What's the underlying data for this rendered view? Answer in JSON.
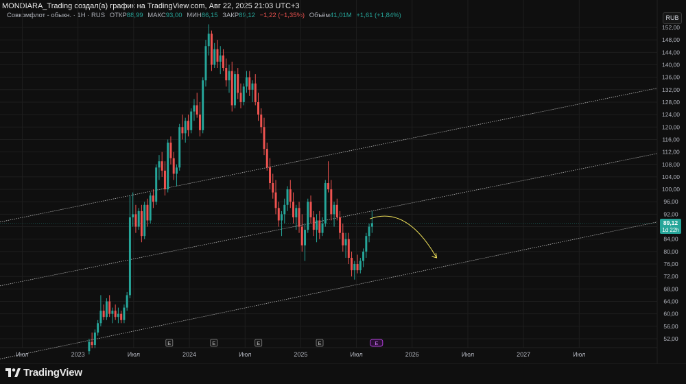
{
  "header": {
    "caption": "MONDIARA_Trading создал(а) график на TradingView.com, Авг 22, 2025 21:03 UTC+3"
  },
  "legend": {
    "symbol": "Совкомфлот - обыкн. · 1Н · RUS",
    "open_label": "ОТКР",
    "open_value": "88,99",
    "high_label": "МАКС",
    "high_value": "93,00",
    "low_label": "МИН",
    "low_value": "86,15",
    "close_label": "ЗАКР",
    "close_value": "89,12",
    "change": "−1,22 (−1,35%)",
    "volume_label": "Объём",
    "volume_value": "41,01M",
    "volume_change": "+1,61 (+1,84%)"
  },
  "currency_button": "RUB",
  "price_tag": {
    "price": "89,12",
    "countdown": "1d 22h"
  },
  "colors": {
    "up": "#26a69a",
    "down": "#ef5350",
    "background": "#0f0f0f",
    "grid": "#1e1e1e",
    "channel": "#d8d8d8",
    "arrow": "#f2e35a",
    "earnings_marker": "#b13fdb"
  },
  "earnings_marker_label": "E",
  "footer": {
    "brand": "TradingView",
    "brand_icon": "tradingview-logo-icon"
  },
  "chart_data": {
    "type": "candlestick",
    "title": "",
    "interval": "1W",
    "ylim": [
      50,
      154
    ],
    "y_ticks": [
      "52,00",
      "56,00",
      "60,00",
      "64,00",
      "68,00",
      "72,00",
      "76,00",
      "80,00",
      "84,00",
      "88,00",
      "92,00",
      "96,00",
      "100,00",
      "104,00",
      "108,00",
      "112,00",
      "116,00",
      "120,00",
      "124,00",
      "128,00",
      "132,00",
      "136,00",
      "140,00",
      "144,00",
      "148,00",
      "152,00"
    ],
    "x_ticks": [
      "Июл",
      "2023",
      "Июл",
      "2024",
      "Июл",
      "2025",
      "Июл",
      "2026",
      "Июл",
      "2027",
      "Июл"
    ],
    "last_price": 89.12,
    "earnings_markers": 6,
    "channel_lines": [
      {
        "name": "upper",
        "from": [
          2022.3,
          89.5
        ],
        "to": [
          2028.2,
          132.5
        ]
      },
      {
        "name": "middle",
        "from": [
          2022.3,
          69.0
        ],
        "to": [
          2028.2,
          111.5
        ]
      },
      {
        "name": "lower",
        "from": [
          2022.3,
          45.5
        ],
        "to": [
          2028.2,
          89.5
        ]
      }
    ],
    "projection_arrow": {
      "from": [
        2025.62,
        90.5
      ],
      "to": [
        2026.22,
        78.0
      ]
    },
    "candles": [
      {
        "o": 48,
        "h": 52,
        "l": 47,
        "c": 51
      },
      {
        "o": 51,
        "h": 54,
        "l": 49,
        "c": 50
      },
      {
        "o": 50,
        "h": 55,
        "l": 49,
        "c": 54
      },
      {
        "o": 54,
        "h": 58,
        "l": 53,
        "c": 57
      },
      {
        "o": 57,
        "h": 66,
        "l": 56,
        "c": 61
      },
      {
        "o": 61,
        "h": 63,
        "l": 58,
        "c": 59
      },
      {
        "o": 59,
        "h": 65,
        "l": 58,
        "c": 64
      },
      {
        "o": 64,
        "h": 66,
        "l": 59,
        "c": 60
      },
      {
        "o": 60,
        "h": 62,
        "l": 57,
        "c": 61
      },
      {
        "o": 61,
        "h": 63,
        "l": 58,
        "c": 59
      },
      {
        "o": 59,
        "h": 62,
        "l": 57,
        "c": 60
      },
      {
        "o": 60,
        "h": 61,
        "l": 57,
        "c": 58
      },
      {
        "o": 58,
        "h": 63,
        "l": 57,
        "c": 62
      },
      {
        "o": 62,
        "h": 67,
        "l": 61,
        "c": 66
      },
      {
        "o": 66,
        "h": 98,
        "l": 65,
        "c": 91
      },
      {
        "o": 91,
        "h": 99,
        "l": 88,
        "c": 92
      },
      {
        "o": 92,
        "h": 95,
        "l": 86,
        "c": 88
      },
      {
        "o": 88,
        "h": 94,
        "l": 87,
        "c": 93
      },
      {
        "o": 93,
        "h": 95,
        "l": 83,
        "c": 85
      },
      {
        "o": 85,
        "h": 96,
        "l": 84,
        "c": 95
      },
      {
        "o": 95,
        "h": 97,
        "l": 88,
        "c": 90
      },
      {
        "o": 90,
        "h": 99,
        "l": 89,
        "c": 98
      },
      {
        "o": 98,
        "h": 100,
        "l": 94,
        "c": 96
      },
      {
        "o": 96,
        "h": 108,
        "l": 95,
        "c": 107
      },
      {
        "o": 107,
        "h": 111,
        "l": 103,
        "c": 109
      },
      {
        "o": 109,
        "h": 112,
        "l": 104,
        "c": 106
      },
      {
        "o": 106,
        "h": 109,
        "l": 98,
        "c": 100
      },
      {
        "o": 100,
        "h": 116,
        "l": 99,
        "c": 115
      },
      {
        "o": 115,
        "h": 117,
        "l": 108,
        "c": 110
      },
      {
        "o": 110,
        "h": 112,
        "l": 103,
        "c": 105
      },
      {
        "o": 105,
        "h": 108,
        "l": 101,
        "c": 107
      },
      {
        "o": 107,
        "h": 121,
        "l": 106,
        "c": 120
      },
      {
        "o": 120,
        "h": 124,
        "l": 116,
        "c": 118
      },
      {
        "o": 118,
        "h": 123,
        "l": 115,
        "c": 122
      },
      {
        "o": 122,
        "h": 124,
        "l": 117,
        "c": 119
      },
      {
        "o": 119,
        "h": 126,
        "l": 118,
        "c": 125
      },
      {
        "o": 125,
        "h": 129,
        "l": 122,
        "c": 127
      },
      {
        "o": 127,
        "h": 131,
        "l": 123,
        "c": 124
      },
      {
        "o": 124,
        "h": 128,
        "l": 117,
        "c": 119
      },
      {
        "o": 119,
        "h": 136,
        "l": 118,
        "c": 135
      },
      {
        "o": 135,
        "h": 148,
        "l": 133,
        "c": 146
      },
      {
        "o": 146,
        "h": 153,
        "l": 143,
        "c": 150
      },
      {
        "o": 150,
        "h": 151,
        "l": 138,
        "c": 140
      },
      {
        "o": 140,
        "h": 147,
        "l": 139,
        "c": 145
      },
      {
        "o": 145,
        "h": 148,
        "l": 139,
        "c": 141
      },
      {
        "o": 141,
        "h": 146,
        "l": 137,
        "c": 143
      },
      {
        "o": 143,
        "h": 145,
        "l": 138,
        "c": 139
      },
      {
        "o": 139,
        "h": 142,
        "l": 133,
        "c": 135
      },
      {
        "o": 135,
        "h": 140,
        "l": 131,
        "c": 138
      },
      {
        "o": 138,
        "h": 141,
        "l": 125,
        "c": 127
      },
      {
        "o": 127,
        "h": 138,
        "l": 126,
        "c": 137
      },
      {
        "o": 137,
        "h": 139,
        "l": 129,
        "c": 131
      },
      {
        "o": 131,
        "h": 134,
        "l": 126,
        "c": 128
      },
      {
        "o": 128,
        "h": 134,
        "l": 127,
        "c": 133
      },
      {
        "o": 133,
        "h": 138,
        "l": 131,
        "c": 136
      },
      {
        "o": 136,
        "h": 138,
        "l": 130,
        "c": 132
      },
      {
        "o": 132,
        "h": 135,
        "l": 128,
        "c": 134
      },
      {
        "o": 134,
        "h": 137,
        "l": 127,
        "c": 128
      },
      {
        "o": 128,
        "h": 131,
        "l": 122,
        "c": 124
      },
      {
        "o": 124,
        "h": 126,
        "l": 118,
        "c": 120
      },
      {
        "o": 120,
        "h": 123,
        "l": 111,
        "c": 113
      },
      {
        "o": 113,
        "h": 115,
        "l": 106,
        "c": 107
      },
      {
        "o": 107,
        "h": 110,
        "l": 100,
        "c": 102
      },
      {
        "o": 102,
        "h": 105,
        "l": 97,
        "c": 99
      },
      {
        "o": 99,
        "h": 103,
        "l": 92,
        "c": 94
      },
      {
        "o": 94,
        "h": 96,
        "l": 88,
        "c": 90
      },
      {
        "o": 90,
        "h": 93,
        "l": 85,
        "c": 92
      },
      {
        "o": 92,
        "h": 97,
        "l": 89,
        "c": 95
      },
      {
        "o": 95,
        "h": 101,
        "l": 93,
        "c": 100
      },
      {
        "o": 100,
        "h": 103,
        "l": 94,
        "c": 96
      },
      {
        "o": 96,
        "h": 99,
        "l": 89,
        "c": 91
      },
      {
        "o": 91,
        "h": 95,
        "l": 87,
        "c": 94
      },
      {
        "o": 94,
        "h": 96,
        "l": 86,
        "c": 88
      },
      {
        "o": 88,
        "h": 92,
        "l": 80,
        "c": 82
      },
      {
        "o": 82,
        "h": 89,
        "l": 77,
        "c": 87
      },
      {
        "o": 87,
        "h": 97,
        "l": 86,
        "c": 96
      },
      {
        "o": 96,
        "h": 98,
        "l": 89,
        "c": 91
      },
      {
        "o": 91,
        "h": 93,
        "l": 85,
        "c": 87
      },
      {
        "o": 87,
        "h": 92,
        "l": 83,
        "c": 90
      },
      {
        "o": 90,
        "h": 93,
        "l": 84,
        "c": 86
      },
      {
        "o": 86,
        "h": 91,
        "l": 85,
        "c": 89
      },
      {
        "o": 89,
        "h": 103,
        "l": 88,
        "c": 102
      },
      {
        "o": 102,
        "h": 109,
        "l": 99,
        "c": 100
      },
      {
        "o": 100,
        "h": 103,
        "l": 90,
        "c": 92
      },
      {
        "o": 92,
        "h": 96,
        "l": 88,
        "c": 95
      },
      {
        "o": 95,
        "h": 97,
        "l": 90,
        "c": 91
      },
      {
        "o": 91,
        "h": 93,
        "l": 84,
        "c": 86
      },
      {
        "o": 86,
        "h": 89,
        "l": 80,
        "c": 82
      },
      {
        "o": 82,
        "h": 86,
        "l": 78,
        "c": 84
      },
      {
        "o": 84,
        "h": 86,
        "l": 76,
        "c": 78
      },
      {
        "o": 78,
        "h": 80,
        "l": 72,
        "c": 74
      },
      {
        "o": 74,
        "h": 77,
        "l": 71,
        "c": 76
      },
      {
        "o": 76,
        "h": 79,
        "l": 73,
        "c": 74
      },
      {
        "o": 74,
        "h": 78,
        "l": 73,
        "c": 77
      },
      {
        "o": 77,
        "h": 81,
        "l": 75,
        "c": 80
      },
      {
        "o": 80,
        "h": 86,
        "l": 78,
        "c": 85
      },
      {
        "o": 85,
        "h": 89,
        "l": 83,
        "c": 88
      },
      {
        "o": 88,
        "h": 93,
        "l": 86,
        "c": 89.12
      }
    ]
  }
}
